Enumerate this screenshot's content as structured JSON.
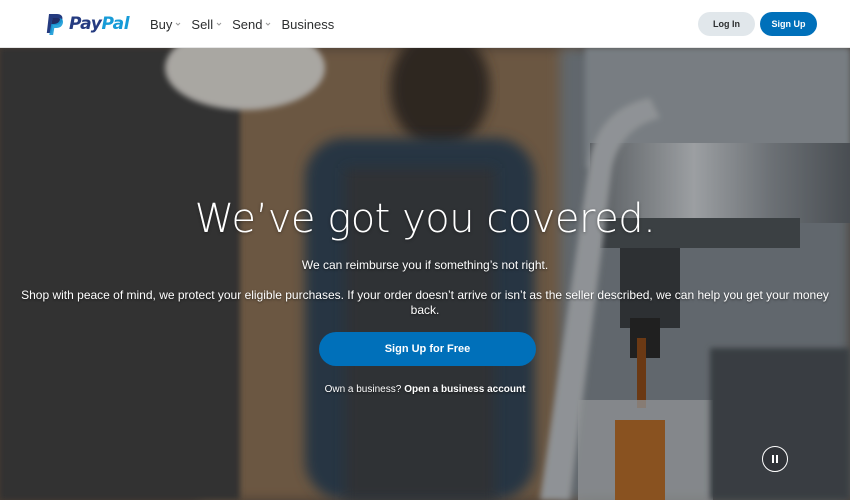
{
  "brand": {
    "name_part1": "Pay",
    "name_part2": "Pal",
    "color_dark": "#253b80",
    "color_light": "#179bd7"
  },
  "nav": {
    "items": [
      {
        "label": "Buy",
        "has_dropdown": true
      },
      {
        "label": "Sell",
        "has_dropdown": true
      },
      {
        "label": "Send",
        "has_dropdown": true
      },
      {
        "label": "Business",
        "has_dropdown": false
      }
    ]
  },
  "header_actions": {
    "login_label": "Log In",
    "signup_label": "Sign Up"
  },
  "hero": {
    "headline": "We’ve got you covered.",
    "subline": "We can reimburse you if something’s not right.",
    "description": "Shop with peace of mind, we protect your eligible purchases. If your order doesn’t arrive or isn’t as the seller described, we can help you get your money back.",
    "cta_label": "Sign Up for Free",
    "business_prompt": "Own a business?",
    "business_link": "Open a business account",
    "pause_icon": "pause-icon"
  },
  "colors": {
    "accent": "#0070ba",
    "login_bg": "#e1e7eb",
    "text_dark": "#2c2e2f"
  }
}
